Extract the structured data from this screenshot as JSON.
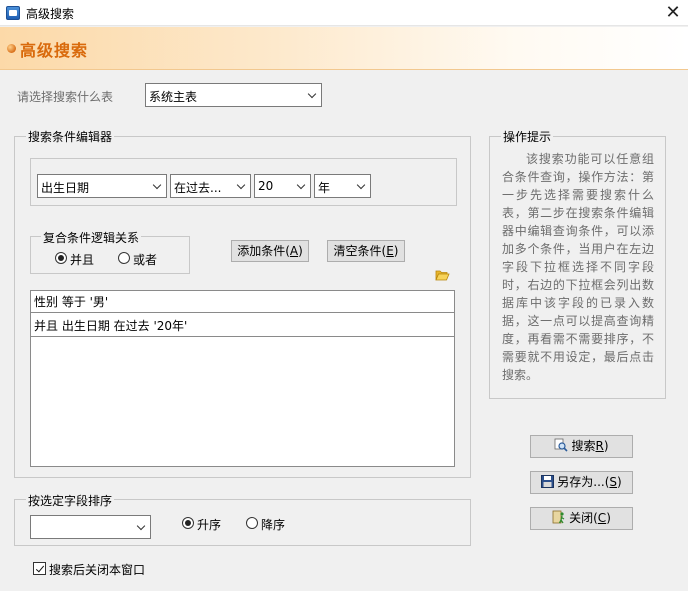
{
  "window": {
    "title": "高级搜索",
    "close_glyph": "✕"
  },
  "header": {
    "title": "高级搜索"
  },
  "table_select": {
    "label": "请选择搜索什么表",
    "value": "系统主表"
  },
  "condition_editor": {
    "caption": "搜索条件编辑器",
    "field": "出生日期",
    "operator": "在过去...",
    "amount": "20",
    "unit": "年",
    "logic": {
      "caption": "复合条件逻辑关系",
      "and_label": "并且",
      "or_label": "或者",
      "selected": "and"
    },
    "add_button": "添加条件(",
    "add_key": "A",
    "clear_button": "清空条件(",
    "clear_key": "E",
    "close_paren": ")",
    "conditions": [
      "性别 等于 '男'",
      "并且 出生日期 在过去 '20年'"
    ]
  },
  "tips": {
    "caption": "操作提示",
    "text": "该搜索功能可以任意组合条件查询，操作方法：第一步先选择需要搜索什么表，第二步在搜索条件编辑器中编辑查询条件，可以添加多个条件，当用户在左边字段下拉框选择不同字段时，右边的下拉框会列出数据库中该字段的已录入数据，这一点可以提高查询精度，再看需不需要排序，不需要就不用设定，最后点击搜索。"
  },
  "actions": {
    "search": {
      "label": "搜索",
      "key": "R",
      "suffix": ")"
    },
    "save_as": {
      "label": "另存为...(",
      "key": "S",
      "suffix": ")"
    },
    "close": {
      "label": "关闭(",
      "key": "C",
      "suffix": ")"
    }
  },
  "sort": {
    "caption": "按选定字段排序",
    "field_value": "",
    "asc_label": "升序",
    "desc_label": "降序",
    "selected": "asc"
  },
  "close_after_search": {
    "label": "搜索后关闭本窗口",
    "checked": true
  }
}
